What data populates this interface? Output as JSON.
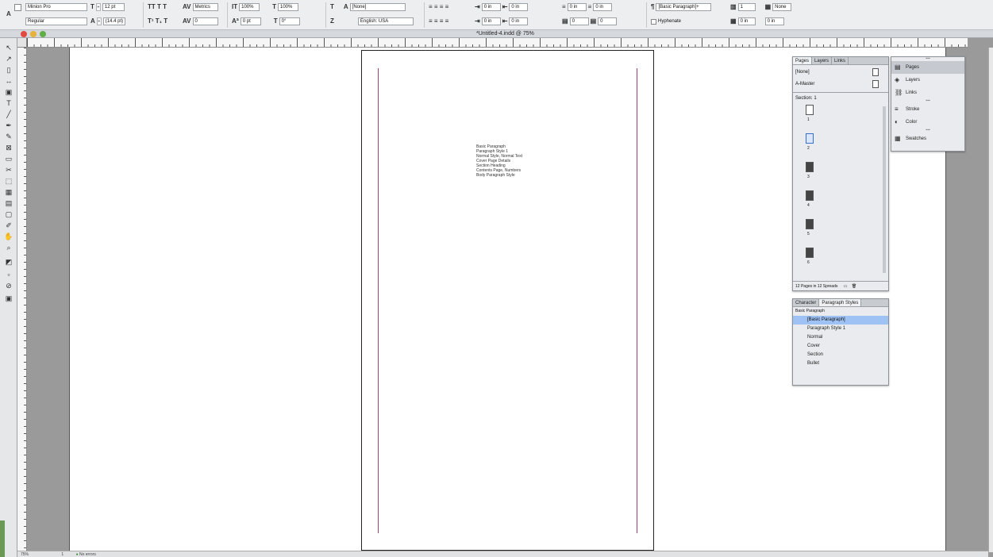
{
  "control_bar": {
    "font_family": "Minion Pro",
    "font_style": "Regular",
    "font_size": "12 pt",
    "leading": "(14.4 pt)",
    "kerning": "Metrics",
    "tracking": "0",
    "h_scale": "100%",
    "v_scale": "100%",
    "baseline": "0 pt",
    "skew": "0°",
    "char_style": "[None]",
    "language": "English: USA",
    "left_indent": "0 in",
    "right_indent": "0 in",
    "first_indent": "0 in",
    "last_indent": "0 in",
    "space_before": "0 in",
    "space_after": "0 in",
    "drop_cap_lines": "0",
    "drop_cap_chars": "0",
    "para_style": "[Basic Paragraph]+",
    "hyphenate": "Hyphenate",
    "columns": "1",
    "col_none": "None",
    "gutter": "0 in",
    "gutter_unit": "0 in"
  },
  "document": {
    "title": "*Untitled-4.indd @ 75%"
  },
  "page_text": [
    "Basic Paragraph",
    "Paragraph Style 1",
    "Normal Style, Normal Text",
    "Cover Page Details",
    "Section Heading",
    "Contents Page, Numbers",
    "Body Paragraph Style"
  ],
  "pages_panel": {
    "tabs": [
      "Pages",
      "Layers",
      "Links"
    ],
    "none_label": "[None]",
    "master_label": "A-Master",
    "section_label": "Section: 1",
    "page_numbers": [
      "1",
      "2",
      "3",
      "4",
      "5",
      "6"
    ],
    "footer": "12 Pages in 12 Spreads"
  },
  "dock": {
    "items": [
      {
        "label": "Pages",
        "icon": "pages-icon"
      },
      {
        "label": "Layers",
        "icon": "layers-icon"
      },
      {
        "label": "Links",
        "icon": "links-icon"
      },
      {
        "label": "Stroke",
        "icon": "stroke-icon"
      },
      {
        "label": "Color",
        "icon": "color-icon"
      },
      {
        "label": "Swatches",
        "icon": "swatches-icon"
      }
    ]
  },
  "styles_panel": {
    "tabs": [
      "Character",
      "Paragraph Styles"
    ],
    "current": "Basic Paragraph",
    "items": [
      "[Basic Paragraph]",
      "Paragraph Style 1",
      "Normal",
      "Cover",
      "Section",
      "Bullet"
    ]
  },
  "status": {
    "zoom": "75%",
    "page": "1",
    "errors": "No errors"
  }
}
